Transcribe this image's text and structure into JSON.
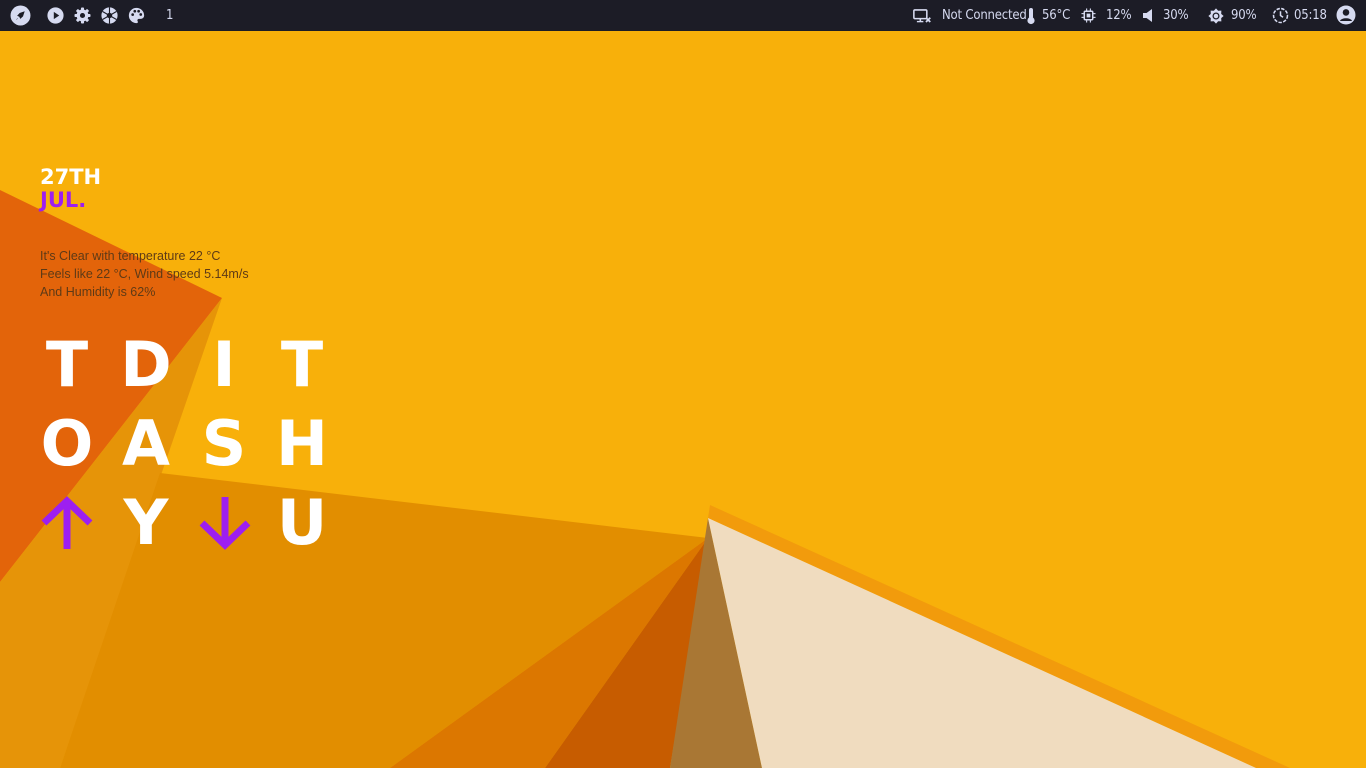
{
  "topbar": {
    "workspace": "1",
    "network": "Not Connected",
    "temperature": "56°C",
    "cpu": "12%",
    "volume": "30%",
    "brightness": "90%",
    "clock": "05:18"
  },
  "widget": {
    "date_day": "27TH",
    "date_month": "JUL.",
    "weather_lines": [
      "It's Clear with temperature 22 °C",
      "Feels like 22 °C, Wind speed 5.14m/s",
      "And Humidity is 62%"
    ],
    "grid": {
      "row1": [
        "T",
        "D",
        "I",
        "T"
      ],
      "row2": [
        "O",
        "A",
        "S",
        "H"
      ],
      "row3": [
        "",
        "Y",
        "",
        "U"
      ]
    }
  },
  "colors": {
    "bar_bg": "#1c1c26",
    "bar_fg": "#d6daf0",
    "wallpaper": "#f8b00a",
    "accent_purple": "#9d1ff0",
    "weather_text": "#5e3a16"
  },
  "icons": {
    "launcher": "rocket-icon",
    "media": "play-icon",
    "settings": "gear-icon",
    "screenshot": "aperture-icon",
    "theme": "palette-icon",
    "network": "disconnected-monitor-icon",
    "temperature": "thermometer-icon",
    "cpu": "cpu-chip-icon",
    "volume": "speaker-icon",
    "brightness": "brightness-icon",
    "clock": "clock-icon",
    "user": "user-icon",
    "up": "arrow-up-icon",
    "down": "arrow-down-icon"
  }
}
